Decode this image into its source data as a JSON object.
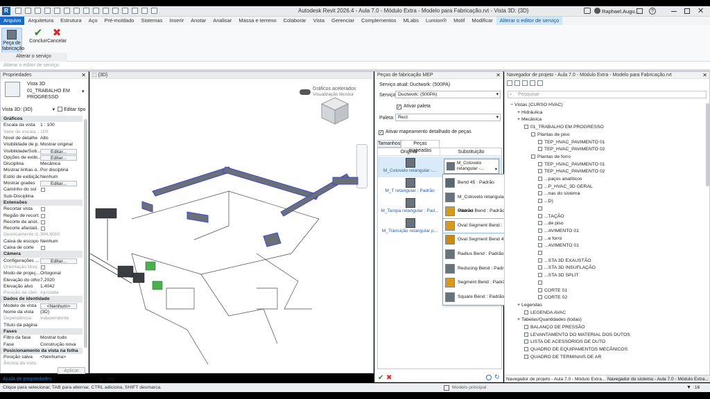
{
  "window": {
    "title": "Autodesk Revit 2026.4 - Aula 7.0 - Módulo Extra - Modelo para Fabricação.rvt - Vista 3D: {3D}",
    "user": "Raphael.Augu..."
  },
  "menu": [
    "Arquivo",
    "Arquitetura",
    "Estrutura",
    "Aço",
    "Pré-moldado",
    "Sistemas",
    "Inserir",
    "Anotar",
    "Analisar",
    "Massa e terreno",
    "Colaborar",
    "Vista",
    "Gerenciar",
    "Complementos",
    "MLabs",
    "Lumion®",
    "Motif",
    "Modificar",
    "Alterar o editor de serviço"
  ],
  "ribbon": {
    "buttons": [
      "Peça de fabricação",
      "Concluir",
      "Cancelar"
    ],
    "panel": "Alterar o serviço",
    "options_bar": "Alterar o editor de serviço"
  },
  "properties": {
    "title": "Propriedades",
    "type_name": "Vista 3D",
    "type_sub": "01_TRABALHO EM PROGRESSO",
    "selector": "Vista 3D: {3D}",
    "edit_type": "Editar tipo",
    "rows": [
      {
        "s": "Gráficos"
      },
      {
        "k": "Escala da vista",
        "v": "1 : 100"
      },
      {
        "k": "Valor de escala ...",
        "v": "100",
        "d": 1
      },
      {
        "k": "Nível de detalhe",
        "v": "Alto"
      },
      {
        "k": "Visibilidade de p...",
        "v": "Mostrar original"
      },
      {
        "k": "Visibilidade/Sob...",
        "b": "Editar..."
      },
      {
        "k": "Opções de exibi...",
        "b": "Editar..."
      },
      {
        "k": "Disciplina",
        "v": "Mecânica"
      },
      {
        "k": "Mostrar linhas o...",
        "v": "Por disciplina"
      },
      {
        "k": "Estilo de exibição...",
        "v": "Nenhum"
      },
      {
        "k": "Mostrar grades",
        "b": "Editar..."
      },
      {
        "k": "Caminho do sol",
        "c": 1
      },
      {
        "k": "Sub-Disciplina",
        "v": ""
      },
      {
        "s": "Extensões"
      },
      {
        "k": "Recortar vista",
        "c": 1
      },
      {
        "k": "Região de recort...",
        "c": 1
      },
      {
        "k": "Recorte de anot...",
        "c": 1
      },
      {
        "k": "Recorte afastad...",
        "c": 1
      },
      {
        "k": "Deslocamento d...",
        "v": "304,8000",
        "d": 1
      },
      {
        "k": "Caixa de escopo",
        "v": "Nenhum"
      },
      {
        "k": "Caixa de corte",
        "c": 1
      },
      {
        "s": "Câmera"
      },
      {
        "k": "Configurações ...",
        "b": "Editar..."
      },
      {
        "k": "Orientação bloq...",
        "c": 1,
        "d": 1
      },
      {
        "k": "Modo de projeç...",
        "v": "Ortogonal"
      },
      {
        "k": "Elevação do olho",
        "v": "7,2020"
      },
      {
        "k": "Elevação alvo",
        "v": "1,4042"
      },
      {
        "k": "Posição da câm...",
        "v": "Ajustada",
        "d": 1
      },
      {
        "s": "Dados de identidade"
      },
      {
        "k": "Modelo de vista",
        "b": "<Nenhum>"
      },
      {
        "k": "Nome da vista",
        "v": "{3D}"
      },
      {
        "k": "Dependência",
        "v": "Independente",
        "d": 1
      },
      {
        "k": "Título da página",
        "v": ""
      },
      {
        "s": "Fases"
      },
      {
        "k": "Filtro da fase",
        "v": "Mostrar tudo"
      },
      {
        "k": "Fase",
        "v": "Construção nova"
      },
      {
        "s": "Posicionamento da vista na folha"
      },
      {
        "k": "Posição salva",
        "v": "<Nenhuma>"
      },
      {
        "k": "Âncora da vista",
        "v": "",
        "d": 1
      }
    ],
    "help": "Ajuda de propriedades",
    "apply": "Aplicar"
  },
  "viewport": {
    "tab": "{3D}",
    "graphics": "Gráficos acelerados",
    "graphics_sub": "Visualização técnica",
    "scale": "1 : 100"
  },
  "mep": {
    "title": "Peças de fabricação MEP",
    "current_service_label": "Serviço atual:",
    "current_service": "Ductwork: (500PA)",
    "service_label": "Serviço:",
    "service": "Ductwork: (500PA)",
    "activate_palette": "Ativar paleta",
    "palette_label": "Paleta:",
    "palette": "Rect",
    "detailed_mapping": "Ativar mapeamento detalhado de peças",
    "tabs": [
      "Tamanhos",
      "Peças mapeadas"
    ],
    "col_original": "Original",
    "col_sub": "Substituição",
    "originals": [
      "M_Cotovelo retangular -...",
      "M_T retangular : Padrão",
      "M_Tampa retangular : Pad...",
      "M_Transição retangular p..."
    ],
    "selected_sub": "M_Cotovelo retangular -...",
    "dropdown": [
      "Bend 45 : Padrão",
      "M_Cotovelo retangular - 90 graus : Padrão",
      "Mitered Bend : Padrão",
      "Oval Segment Bend : Padrão",
      "Oval Segment Bend 45 : Padrão",
      "Radius Bend : Padrão",
      "Reducing Bend : Padrão",
      "Segment Bend : Padrão",
      "Square Bend : Padrão"
    ]
  },
  "browser": {
    "title": "Navegador de projeto - Aula 7.0 - Módulo Extra - Modelo para Fabricação.rvt",
    "search": "Pesquisar",
    "tree": [
      {
        "t": "Vistas (CURSO HVAC)",
        "l": 0
      },
      {
        "t": "Hidráulica",
        "l": 1
      },
      {
        "t": "Mecânica",
        "l": 1
      },
      {
        "t": "01_TRABALHO EM PROGRESSO",
        "l": 2
      },
      {
        "t": "Plantas de piso",
        "l": 3
      },
      {
        "t": "TEP_HVAC_PAVIMENTO 01",
        "l": 4
      },
      {
        "t": "TEP_HVAC_PAVIMENTO 02",
        "l": 4
      },
      {
        "t": "Plantas de forro",
        "l": 3
      },
      {
        "t": "TEP_HVAC_PAVIMENTO 01",
        "l": 4
      },
      {
        "t": "TEP_HVAC_PAVIMENTO 02",
        "l": 4
      },
      {
        "t": "...paços analíticos",
        "l": 4
      },
      {
        "t": "...P_HVAC_3D GERAL",
        "l": 4
      },
      {
        "t": "...nas do sistema",
        "l": 4
      },
      {
        "t": "...D)",
        "l": 4
      },
      {
        "t": "",
        "l": 4
      },
      {
        "t": "...TAÇÃO",
        "l": 4
      },
      {
        "t": "...de piso",
        "l": 4
      },
      {
        "t": "...AVIMENTO 01",
        "l": 4
      },
      {
        "t": "...e forro",
        "l": 4
      },
      {
        "t": "...AVIMENTO 01",
        "l": 4
      },
      {
        "t": "",
        "l": 4
      },
      {
        "t": "...STA 3D EXAUSTÃO",
        "l": 4
      },
      {
        "t": "...STA 3D INSUFLAÇÃO",
        "l": 4
      },
      {
        "t": "...STA 3D SPLIT",
        "l": 4
      },
      {
        "t": "",
        "l": 4
      },
      {
        "t": "CORTE 01",
        "l": 4
      },
      {
        "t": "CORTE 02",
        "l": 4
      },
      {
        "t": "Legendas",
        "l": 1
      },
      {
        "t": "LEGENDA AVAC",
        "l": 2
      },
      {
        "t": "Tabelas/Quantidades (todas)",
        "l": 1
      },
      {
        "t": "BALANÇO DE PRESSÃO",
        "l": 2
      },
      {
        "t": "LEVANTAMENTO DO MATERIAL DOS DUTOS",
        "l": 2
      },
      {
        "t": "LISTA DE ACESSÓRIOS DE DUTO",
        "l": 2
      },
      {
        "t": "QUADRO DE EQUIPAMENTOS MECÂNICOS",
        "l": 2
      },
      {
        "t": "QUADRO DE TERMINAIS DE AR",
        "l": 2
      }
    ],
    "bottom_tabs": [
      "Navegador de projeto - Aula 7.0 - Módulo Extra...",
      "Navegador do sistema - Aula 7.0 - Módulo Extra..."
    ]
  },
  "status": {
    "left": "Clique para selecionar, TAB para alternar, CTRL adiciona, SHIFT desmarca.",
    "model": "Modelo principal",
    "count": ":16"
  }
}
